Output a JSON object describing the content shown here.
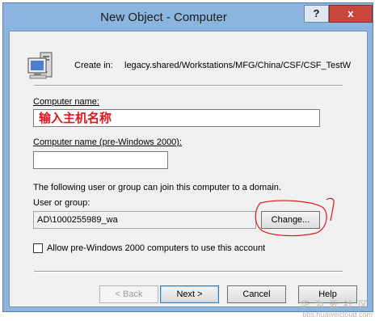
{
  "window": {
    "title": "New Object - Computer",
    "help_glyph": "?",
    "close_glyph": "x"
  },
  "create_in": {
    "label": "Create in:",
    "path": "legacy.shared/Workstations/MFG/China/CSF/CSF_TestW"
  },
  "computer_name": {
    "label": "Computer name:",
    "value": "输入主机名称"
  },
  "pre2000_name": {
    "label": "Computer name (pre-Windows 2000):",
    "value": ""
  },
  "join_note": "The following user or group can join this computer to a domain.",
  "user_group": {
    "label": "User or group:",
    "value": "AD\\1000255989_wa",
    "change_label": "Change..."
  },
  "allow_pre2000": {
    "label": "Allow pre-Windows 2000 computers to use this account",
    "checked": false
  },
  "footer": {
    "back_label": "< Back",
    "next_label": "Next >",
    "cancel_label": "Cancel",
    "help_label": "Help"
  },
  "watermark": {
    "title": "华为云社区",
    "url": "bbs.huaweicloud.com"
  },
  "colors": {
    "frame": "#8bb4df",
    "client": "#f0f0f0",
    "close_button": "#c9463d",
    "annotation_red": "#e0141b"
  }
}
